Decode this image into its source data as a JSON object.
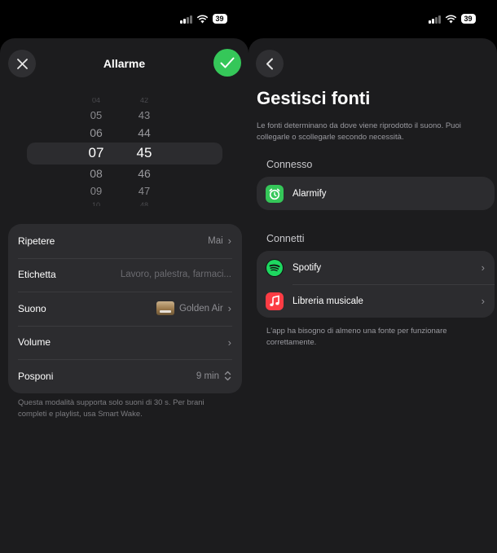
{
  "status_bar": {
    "battery": "39"
  },
  "left": {
    "header": {
      "title": "Allarme"
    },
    "picker": {
      "hours": [
        "04",
        "05",
        "06",
        "07",
        "08",
        "09",
        "10"
      ],
      "minutes": [
        "42",
        "43",
        "44",
        "45",
        "46",
        "47",
        "48"
      ],
      "selected_hour": "07",
      "selected_minute": "45"
    },
    "settings": [
      {
        "label": "Ripetere",
        "value": "Mai"
      },
      {
        "label": "Etichetta",
        "value": "Lavoro, palestra, farmaci..."
      },
      {
        "label": "Suono",
        "value": "Golden Air"
      },
      {
        "label": "Volume",
        "value": ""
      },
      {
        "label": "Posponi",
        "value": "9 min"
      }
    ],
    "footnote": "Questa modalità supporta solo suoni di 30 s. Per brani completi e playlist, usa Smart Wake."
  },
  "right": {
    "title": "Gestisci fonti",
    "description": "Le fonti determinano da dove viene riprodotto il suono. Puoi collegarle o scollegarle secondo necessità.",
    "connected_header": "Connesso",
    "connected_sources": [
      {
        "label": "Alarmify",
        "icon": "alarm-clock-icon",
        "color": "#35c759"
      }
    ],
    "connect_header": "Connetti",
    "available_sources": [
      {
        "label": "Spotify",
        "icon": "spotify-icon",
        "color": "#1ed760"
      },
      {
        "label": "Libreria musicale",
        "icon": "music-note-icon",
        "color": "#fc3c44"
      }
    ],
    "footnote": "L'app ha bisogno di almeno una fonte per funzionare correttamente."
  }
}
